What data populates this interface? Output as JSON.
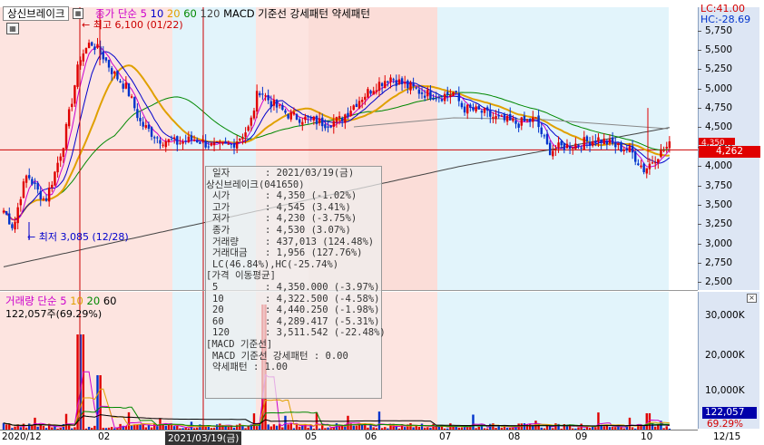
{
  "header": {
    "stock_name": "상신브레이크",
    "indicator_label": "종가 단순",
    "ma_periods": [
      "5",
      "10",
      "20",
      "60",
      "120"
    ],
    "ma_colors": [
      "#cc00cc",
      "#0000cc",
      "#e0a000",
      "#008800",
      "#444444"
    ],
    "pattern_text": "MACD 기준선 강세패턴  약세패턴"
  },
  "annotations": {
    "high": "최고 6,100 (01/22)",
    "low": "최저 3,085 (12/28)"
  },
  "top_right": {
    "lc": "LC:41.00",
    "hc": "HC:-28.69"
  },
  "price_axis": [
    "5,750",
    "5,500",
    "5,250",
    "5,000",
    "4,750",
    "4,500",
    "4,250",
    "4,000",
    "3,750",
    "3,500",
    "3,250",
    "3,000",
    "2,750",
    "2,500"
  ],
  "price_badges": {
    "current": "4,262",
    "ref": "4,350"
  },
  "volume_panel": {
    "title": "거래량",
    "indicator_label": "단순",
    "ma_periods": [
      "5",
      "10",
      "20",
      "60"
    ],
    "ma_colors": [
      "#cc00cc",
      "#e0a000",
      "#008800",
      "#000000"
    ],
    "current": "122,057주(69.29%)",
    "axis": [
      "30,000K",
      "20,000K",
      "10,000K"
    ],
    "badge_value": "122,057",
    "badge_pct": "69.29%"
  },
  "date_axis": [
    "2020/12",
    "02",
    "2021/03/19(금)",
    "05",
    "06",
    "07",
    "08",
    "09",
    "10",
    "12/15"
  ],
  "tooltip": {
    "date_key": "일자",
    "date_val": ": 2021/03/19(금)",
    "name_line": "상신브레이크(041650)",
    "rows": [
      {
        "k": "시가",
        "v": ": 4,350 (-1.02%)"
      },
      {
        "k": "고가",
        "v": ": 4,545 (3.41%)"
      },
      {
        "k": "저가",
        "v": ": 4,230 (-3.75%)"
      },
      {
        "k": "종가",
        "v": ": 4,530 (3.07%)"
      },
      {
        "k": "거래량",
        "v": ": 437,013 (124.48%)"
      },
      {
        "k": "거래대금",
        "v": ": 1,956 (127.76%)"
      }
    ],
    "lchc": "LC(46.84%),HC(-25.74%)",
    "ma_header": "[가격 이동평균]",
    "ma_rows": [
      {
        "k": "5",
        "v": ": 4,350.000 (-3.97%)"
      },
      {
        "k": "10",
        "v": ": 4,322.500 (-4.58%)"
      },
      {
        "k": "20",
        "v": ": 4,440.250 (-1.98%)"
      },
      {
        "k": "60",
        "v": ": 4,289.417 (-5.31%)"
      },
      {
        "k": "120",
        "v": ": 3,511.542 (-22.48%)"
      }
    ],
    "macd_header": "[MACD 기준선]",
    "macd_line": "MACD 기준선 강세패턴 : 0.00",
    "weak_line": "약세패턴 : 1.00"
  },
  "chart_data": {
    "type": "candlestick",
    "x": [
      "2020/12",
      "02",
      "2021/03/19(금)",
      "05",
      "06",
      "07",
      "08",
      "09",
      "10",
      "12/15"
    ],
    "high": {
      "value": 6100,
      "date": "01/22"
    },
    "low": {
      "value": 3085,
      "date": "12/28"
    },
    "ylim": [
      2400,
      6050
    ],
    "selected": {
      "date": "2021/03/19",
      "open": 4350,
      "high": 4545,
      "low": 4230,
      "close": 4530,
      "volume": 437013
    },
    "last_close": 4262,
    "reference_line": 4350
  }
}
